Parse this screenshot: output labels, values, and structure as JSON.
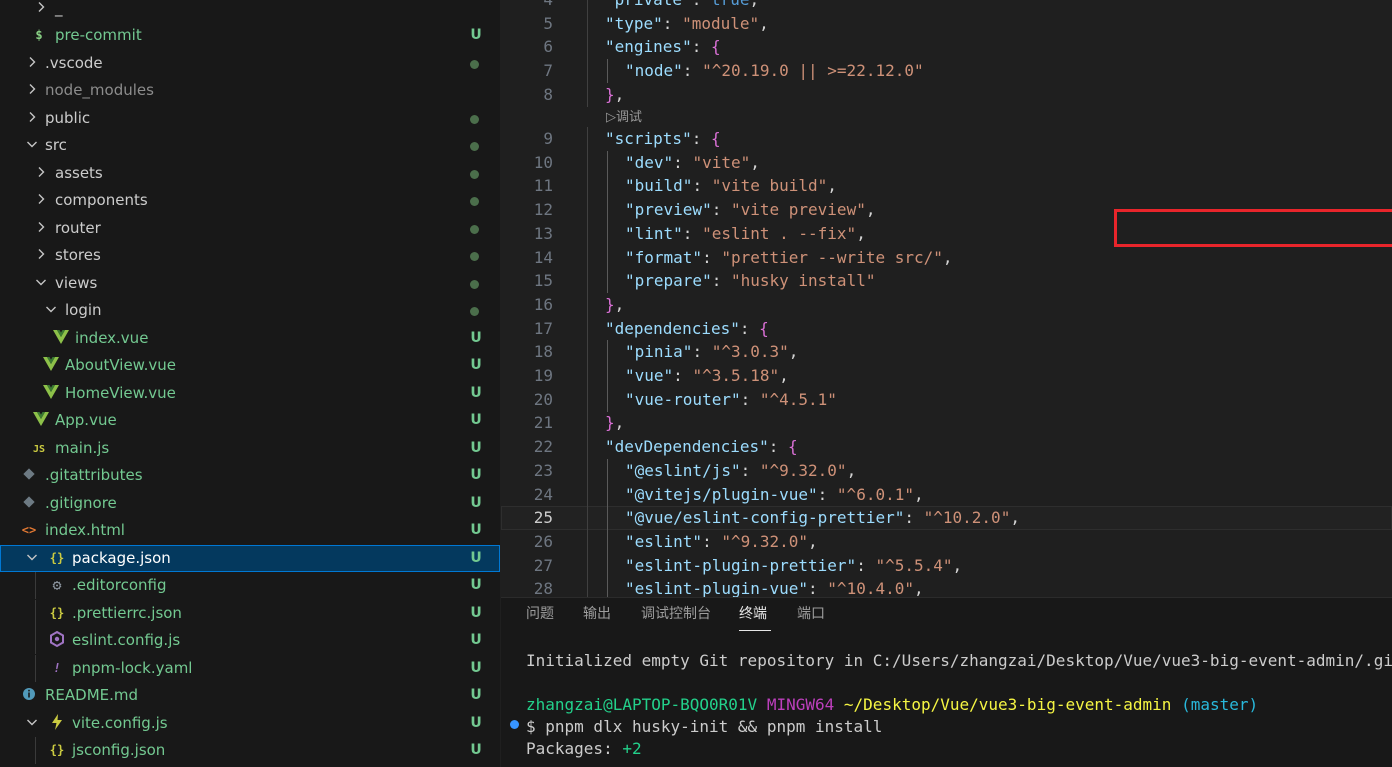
{
  "explorer": {
    "rows": [
      {
        "label": "_",
        "badge": ""
      },
      {
        "label": "pre-commit",
        "badge": "U"
      },
      {
        "label": ".vscode",
        "badge": ""
      },
      {
        "label": "node_modules",
        "badge": ""
      },
      {
        "label": "public",
        "badge": ""
      },
      {
        "label": "src",
        "badge": ""
      },
      {
        "label": "assets",
        "badge": ""
      },
      {
        "label": "components",
        "badge": ""
      },
      {
        "label": "router",
        "badge": ""
      },
      {
        "label": "stores",
        "badge": ""
      },
      {
        "label": "views",
        "badge": ""
      },
      {
        "label": "login",
        "badge": ""
      },
      {
        "label": "index.vue",
        "badge": "U"
      },
      {
        "label": "AboutView.vue",
        "badge": "U"
      },
      {
        "label": "HomeView.vue",
        "badge": "U"
      },
      {
        "label": "App.vue",
        "badge": "U"
      },
      {
        "label": "main.js",
        "badge": "U"
      },
      {
        "label": ".gitattributes",
        "badge": "U"
      },
      {
        "label": ".gitignore",
        "badge": "U"
      },
      {
        "label": "index.html",
        "badge": "U"
      },
      {
        "label": "package.json",
        "badge": "U"
      },
      {
        "label": ".editorconfig",
        "badge": "U"
      },
      {
        "label": ".prettierrc.json",
        "badge": "U"
      },
      {
        "label": "eslint.config.js",
        "badge": "U"
      },
      {
        "label": "pnpm-lock.yaml",
        "badge": "U"
      },
      {
        "label": "README.md",
        "badge": "U"
      },
      {
        "label": "vite.config.js",
        "badge": "U"
      },
      {
        "label": "jsconfig.json",
        "badge": "U"
      }
    ]
  },
  "editor": {
    "codelens": "▷调试",
    "lines": [
      {
        "n": "4",
        "tokens": [
          {
            "c": "k",
            "t": "\"private\""
          },
          {
            "c": "p",
            "t": ": "
          },
          {
            "c": "b",
            "t": "true"
          },
          {
            "c": "p",
            "t": ","
          }
        ]
      },
      {
        "n": "5",
        "tokens": [
          {
            "c": "k",
            "t": "\"type\""
          },
          {
            "c": "p",
            "t": ": "
          },
          {
            "c": "s",
            "t": "\"module\""
          },
          {
            "c": "p",
            "t": ","
          }
        ]
      },
      {
        "n": "6",
        "tokens": [
          {
            "c": "k",
            "t": "\"engines\""
          },
          {
            "c": "p",
            "t": ": "
          },
          {
            "c": "b2",
            "t": "{"
          }
        ]
      },
      {
        "n": "7",
        "tokens": [
          {
            "c": "k",
            "t": "\"node\""
          },
          {
            "c": "p",
            "t": ": "
          },
          {
            "c": "s",
            "t": "\"^20.19.0 || >=22.12.0\""
          }
        ]
      },
      {
        "n": "8",
        "tokens": [
          {
            "c": "b2",
            "t": "}"
          },
          {
            "c": "p",
            "t": ","
          }
        ]
      },
      {
        "n": "9",
        "tokens": [
          {
            "c": "k",
            "t": "\"scripts\""
          },
          {
            "c": "p",
            "t": ": "
          },
          {
            "c": "b2",
            "t": "{"
          }
        ]
      },
      {
        "n": "10",
        "tokens": [
          {
            "c": "k",
            "t": "\"dev\""
          },
          {
            "c": "p",
            "t": ": "
          },
          {
            "c": "s",
            "t": "\"vite\""
          },
          {
            "c": "p",
            "t": ","
          }
        ]
      },
      {
        "n": "11",
        "tokens": [
          {
            "c": "k",
            "t": "\"build\""
          },
          {
            "c": "p",
            "t": ": "
          },
          {
            "c": "s",
            "t": "\"vite build\""
          },
          {
            "c": "p",
            "t": ","
          }
        ]
      },
      {
        "n": "12",
        "tokens": [
          {
            "c": "k",
            "t": "\"preview\""
          },
          {
            "c": "p",
            "t": ": "
          },
          {
            "c": "s",
            "t": "\"vite preview\""
          },
          {
            "c": "p",
            "t": ","
          }
        ]
      },
      {
        "n": "13",
        "tokens": [
          {
            "c": "k",
            "t": "\"lint\""
          },
          {
            "c": "p",
            "t": ": "
          },
          {
            "c": "s",
            "t": "\"eslint . --fix\""
          },
          {
            "c": "p",
            "t": ","
          }
        ]
      },
      {
        "n": "14",
        "tokens": [
          {
            "c": "k",
            "t": "\"format\""
          },
          {
            "c": "p",
            "t": ": "
          },
          {
            "c": "s",
            "t": "\"prettier --write src/\""
          },
          {
            "c": "p",
            "t": ","
          }
        ]
      },
      {
        "n": "15",
        "tokens": [
          {
            "c": "k",
            "t": "\"prepare\""
          },
          {
            "c": "p",
            "t": ": "
          },
          {
            "c": "s",
            "t": "\"husky install\""
          }
        ]
      },
      {
        "n": "16",
        "tokens": [
          {
            "c": "b2",
            "t": "}"
          },
          {
            "c": "p",
            "t": ","
          }
        ]
      },
      {
        "n": "17",
        "tokens": [
          {
            "c": "k",
            "t": "\"dependencies\""
          },
          {
            "c": "p",
            "t": ": "
          },
          {
            "c": "b2",
            "t": "{"
          }
        ]
      },
      {
        "n": "18",
        "tokens": [
          {
            "c": "k",
            "t": "\"pinia\""
          },
          {
            "c": "p",
            "t": ": "
          },
          {
            "c": "s",
            "t": "\"^3.0.3\""
          },
          {
            "c": "p",
            "t": ","
          }
        ]
      },
      {
        "n": "19",
        "tokens": [
          {
            "c": "k",
            "t": "\"vue\""
          },
          {
            "c": "p",
            "t": ": "
          },
          {
            "c": "s",
            "t": "\"^3.5.18\""
          },
          {
            "c": "p",
            "t": ","
          }
        ]
      },
      {
        "n": "20",
        "tokens": [
          {
            "c": "k",
            "t": "\"vue-router\""
          },
          {
            "c": "p",
            "t": ": "
          },
          {
            "c": "s",
            "t": "\"^4.5.1\""
          }
        ]
      },
      {
        "n": "21",
        "tokens": [
          {
            "c": "b2",
            "t": "}"
          },
          {
            "c": "p",
            "t": ","
          }
        ]
      },
      {
        "n": "22",
        "tokens": [
          {
            "c": "k",
            "t": "\"devDependencies\""
          },
          {
            "c": "p",
            "t": ": "
          },
          {
            "c": "b2",
            "t": "{"
          }
        ]
      },
      {
        "n": "23",
        "tokens": [
          {
            "c": "k",
            "t": "\"@eslint/js\""
          },
          {
            "c": "p",
            "t": ": "
          },
          {
            "c": "s",
            "t": "\"^9.32.0\""
          },
          {
            "c": "p",
            "t": ","
          }
        ]
      },
      {
        "n": "24",
        "tokens": [
          {
            "c": "k",
            "t": "\"@vitejs/plugin-vue\""
          },
          {
            "c": "p",
            "t": ": "
          },
          {
            "c": "s",
            "t": "\"^6.0.1\""
          },
          {
            "c": "p",
            "t": ","
          }
        ]
      },
      {
        "n": "25",
        "tokens": [
          {
            "c": "k",
            "t": "\"@vue/eslint-config-prettier\""
          },
          {
            "c": "p",
            "t": ": "
          },
          {
            "c": "s",
            "t": "\"^10.2.0\""
          },
          {
            "c": "p",
            "t": ","
          }
        ]
      },
      {
        "n": "26",
        "tokens": [
          {
            "c": "k",
            "t": "\"eslint\""
          },
          {
            "c": "p",
            "t": ": "
          },
          {
            "c": "s",
            "t": "\"^9.32.0\""
          },
          {
            "c": "p",
            "t": ","
          }
        ]
      },
      {
        "n": "27",
        "tokens": [
          {
            "c": "k",
            "t": "\"eslint-plugin-prettier\""
          },
          {
            "c": "p",
            "t": ": "
          },
          {
            "c": "s",
            "t": "\"^5.5.4\""
          },
          {
            "c": "p",
            "t": ","
          }
        ]
      },
      {
        "n": "28",
        "tokens": [
          {
            "c": "k",
            "t": "\"eslint-plugin-vue\""
          },
          {
            "c": "p",
            "t": ": "
          },
          {
            "c": "s",
            "t": "\"^10.4.0\""
          },
          {
            "c": "p",
            "t": ","
          }
        ]
      }
    ]
  },
  "panel": {
    "tabs": [
      "问题",
      "输出",
      "调试控制台",
      "终端",
      "端口"
    ],
    "active_tab": "终端",
    "terminal": {
      "init_line": "Initialized empty Git repository in C:/Users/zhangzai/Desktop/Vue/vue3-big-event-admin/.git/",
      "prompt_user": "zhangzai@LAPTOP-BQO0R01V",
      "prompt_env": "MINGW64",
      "prompt_path": "~/Desktop/Vue/vue3-big-event-admin",
      "prompt_branch": "(master)",
      "command": "$ pnpm dlx husky-init && pnpm install",
      "packages_label": "Packages:",
      "packages_value": "+2"
    }
  },
  "colors": {
    "untracked": "#73c991",
    "folder_text": "#cccccc",
    "ignored_text": "#8c8c8c",
    "accent": "#0078d4",
    "annotation": "#e8252b"
  },
  "icons": [
    "chevron-right-icon",
    "chevron-down-icon",
    "dollar-icon",
    "vue-icon",
    "js-icon",
    "git-icon",
    "html-icon",
    "json-icon",
    "gear-icon",
    "eslint-icon",
    "yaml-icon",
    "info-icon",
    "vite-icon"
  ]
}
